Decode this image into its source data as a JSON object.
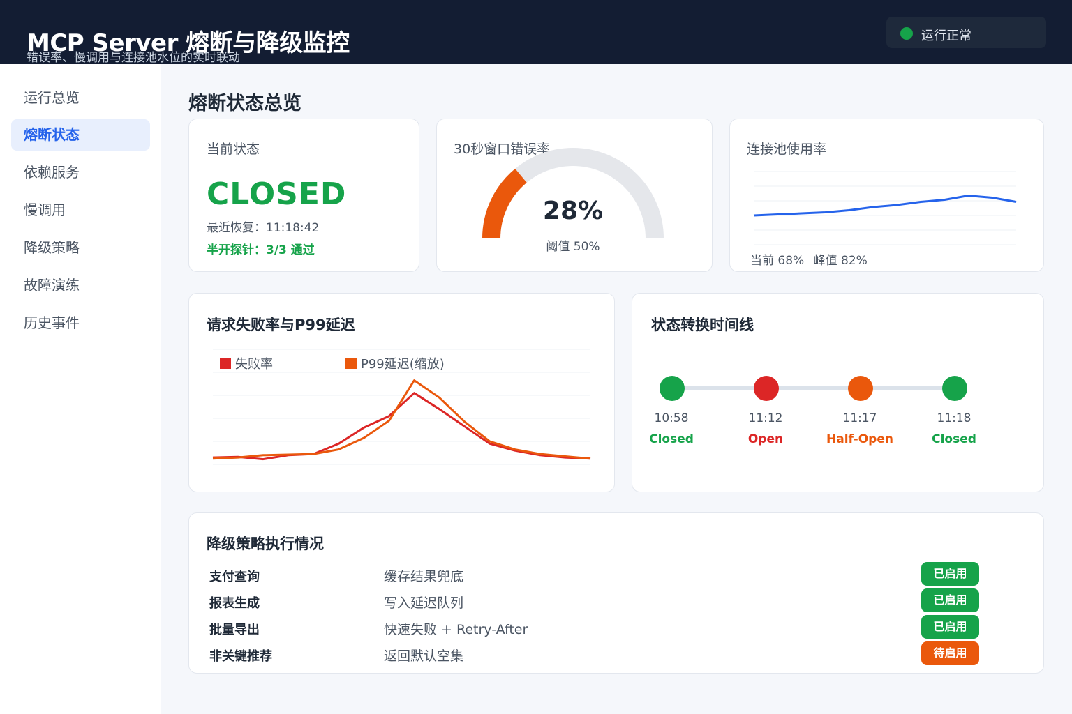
{
  "header": {
    "title": "MCP Server 熔断与降级监控",
    "subtitle": "错误率、慢调用与连接池水位的实时联动",
    "status_label": "运行正常"
  },
  "sidebar": {
    "items": [
      {
        "label": "运行总览",
        "active": false
      },
      {
        "label": "熔断状态",
        "active": true
      },
      {
        "label": "依赖服务",
        "active": false
      },
      {
        "label": "慢调用",
        "active": false
      },
      {
        "label": "降级策略",
        "active": false
      },
      {
        "label": "故障演练",
        "active": false
      },
      {
        "label": "历史事件",
        "active": false
      }
    ]
  },
  "overview": {
    "title": "熔断状态总览",
    "state_card": {
      "label": "当前状态",
      "state": "CLOSED",
      "recover": "最近恢复：11:18:42",
      "probe": "半开探针：3/3 通过"
    },
    "error_card": {
      "label": "30秒窗口错误率",
      "value_text": "28%",
      "value": 28,
      "threshold_text": "阈值 50%"
    },
    "pool_card": {
      "label": "连接池使用率",
      "current": "当前 68%",
      "peak": "峰值 82%"
    }
  },
  "chart_data": [
    {
      "type": "line",
      "title": "请求失败率与P99延迟",
      "x": [
        0,
        1,
        2,
        3,
        4,
        5,
        6,
        7,
        8,
        9,
        10,
        11,
        12,
        13,
        14,
        15
      ],
      "series": [
        {
          "name": "失败率",
          "color": "#dc2626",
          "values": [
            6,
            6.5,
            4.5,
            8,
            9,
            18,
            32,
            42,
            62,
            48,
            33,
            18,
            12,
            8,
            6,
            5
          ]
        },
        {
          "name": "P99延迟(缩放)",
          "color": "#ea580c",
          "values": [
            5,
            6,
            8,
            8.5,
            9,
            13,
            23,
            38,
            73,
            58,
            37,
            20,
            13,
            9,
            7,
            5
          ]
        }
      ],
      "ylim": [
        0,
        100
      ],
      "grid": true,
      "legend": "top-left"
    },
    {
      "type": "line",
      "title": "连接池使用率",
      "x": [
        0,
        1,
        2,
        3,
        4,
        5,
        6,
        7,
        8,
        9,
        10,
        11
      ],
      "series": [
        {
          "name": "",
          "color": "#2563eb",
          "values": [
            58,
            59,
            60,
            61,
            63,
            66,
            68,
            71,
            73,
            77,
            75,
            71
          ]
        }
      ],
      "ylim": [
        30,
        100
      ],
      "grid": true
    }
  ],
  "timeline": {
    "title": "状态转换时间线",
    "events": [
      {
        "time": "10:58",
        "state": "Closed",
        "color": "#16a34a"
      },
      {
        "time": "11:12",
        "state": "Open",
        "color": "#dc2626"
      },
      {
        "time": "11:17",
        "state": "Half-Open",
        "color": "#ea580c"
      },
      {
        "time": "11:18",
        "state": "Closed",
        "color": "#16a34a"
      }
    ]
  },
  "degrade": {
    "title": "降级策略执行情况",
    "rows": [
      {
        "name": "支付查询",
        "action": "缓存结果兜底",
        "status": "已启用",
        "color": "#16a34a"
      },
      {
        "name": "报表生成",
        "action": "写入延迟队列",
        "status": "已启用",
        "color": "#16a34a"
      },
      {
        "name": "批量导出",
        "action": "快速失败 + Retry-After",
        "status": "已启用",
        "color": "#16a34a"
      },
      {
        "name": "非关键推荐",
        "action": "返回默认空集",
        "status": "待启用",
        "color": "#ea580c"
      }
    ]
  },
  "colors": {
    "header_bg": "#131d33",
    "accent_blue": "#2563eb",
    "ok_green": "#16a34a",
    "error_red": "#dc2626",
    "warn_orange": "#ea580c",
    "gauge_track": "#e5e7eb"
  }
}
